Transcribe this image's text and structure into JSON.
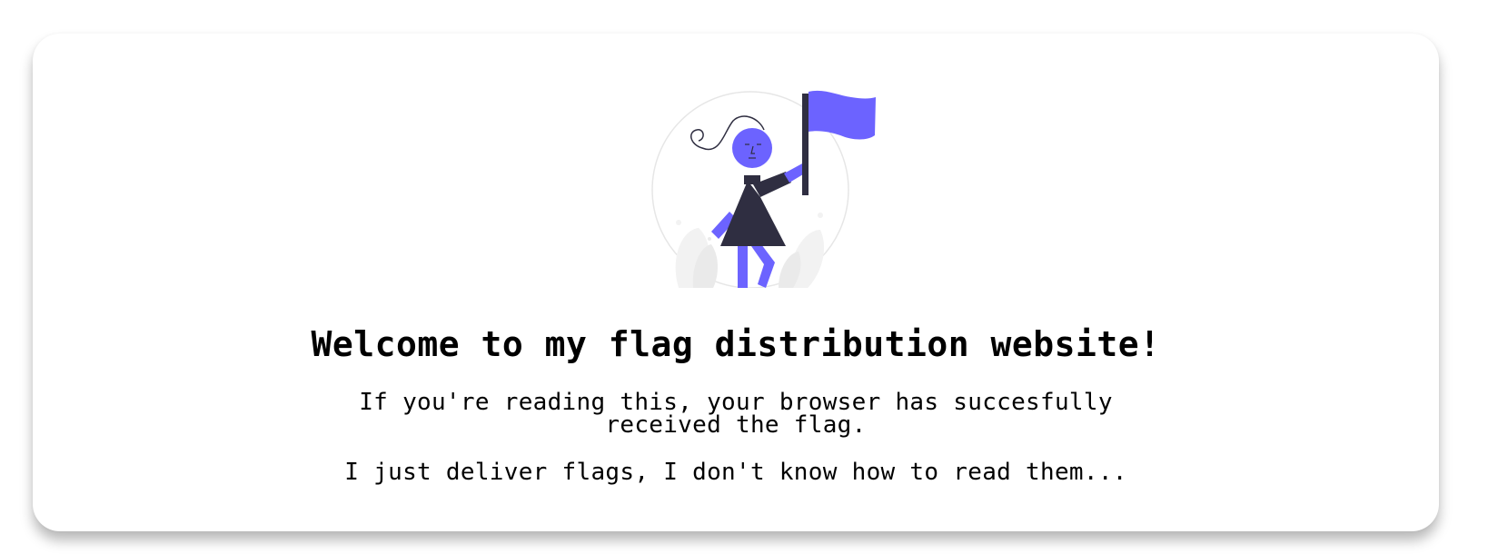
{
  "page": {
    "heading": "Welcome to my flag distribution website!",
    "message_line1": "If you're reading this, your browser has succesfully",
    "message_line2": "received the flag.",
    "message_secondary": "I just deliver flags, I don't know how to read them..."
  },
  "illustration": {
    "icon": "person-holding-flag-illustration",
    "accent_color": "#6c63ff",
    "dark_color": "#2f2e41",
    "light_color": "#f2f2f2"
  }
}
